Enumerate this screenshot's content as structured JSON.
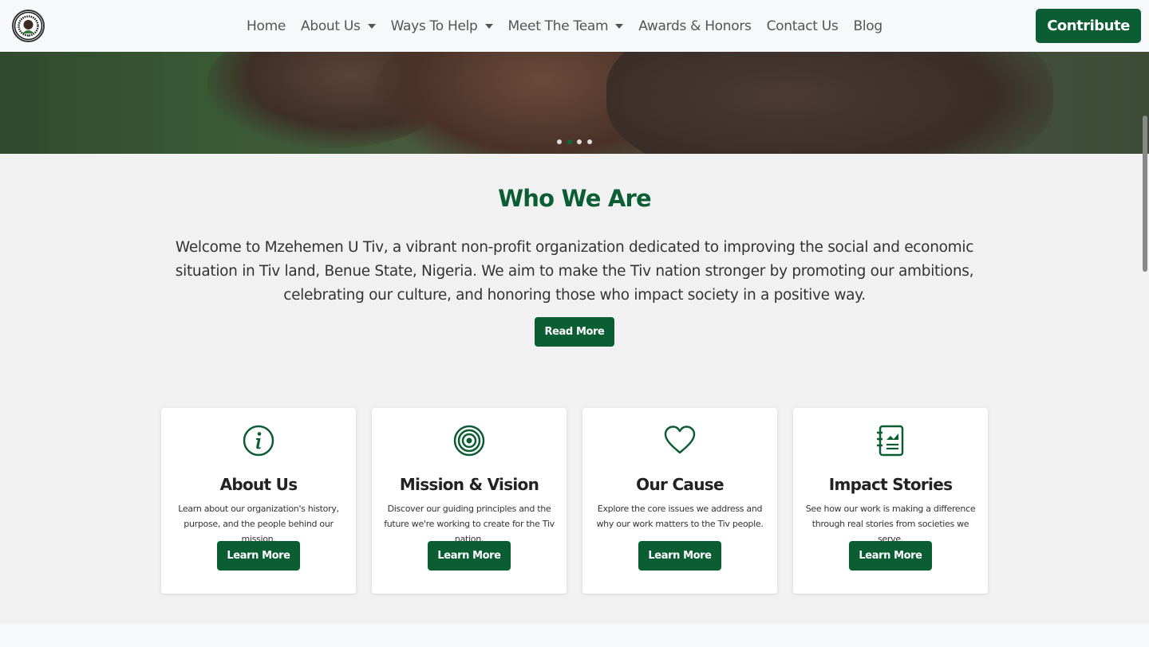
{
  "nav": {
    "links": [
      {
        "label": "Home",
        "active": true,
        "dropdown": false
      },
      {
        "label": "About Us",
        "active": false,
        "dropdown": true
      },
      {
        "label": "Ways To Help",
        "active": false,
        "dropdown": true
      },
      {
        "label": "Meet The Team",
        "active": false,
        "dropdown": true
      },
      {
        "label": "Awards & Honors",
        "active": false,
        "dropdown": false
      },
      {
        "label": "Contact Us",
        "active": false,
        "dropdown": false
      },
      {
        "label": "Blog",
        "active": false,
        "dropdown": false
      }
    ],
    "contribute_label": "Contribute"
  },
  "hero": {
    "slide_count": 4,
    "active_slide": 2
  },
  "who_we_are": {
    "title": "Who We Are",
    "text": "Welcome to Mzehemen U Tiv, a vibrant non-profit organization dedicated to improving the social and economic situation in Tiv land, Benue State, Nigeria. We aim to make the Tiv nation stronger by promoting our ambitions, celebrating our culture, and honoring those who impact society in a positive way.",
    "button_label": "Read More"
  },
  "cards": [
    {
      "icon": "info-icon",
      "title": "About Us",
      "desc": "Learn about our organization's history, purpose, and the people behind our mission.",
      "button": "Learn More"
    },
    {
      "icon": "target-icon",
      "title": "Mission & Vision",
      "desc": "Discover our guiding principles and the future we're working to create for the Tiv nation.",
      "button": "Learn More"
    },
    {
      "icon": "heart-icon",
      "title": "Our Cause",
      "desc": "Explore the core issues we address and why our work matters to the Tiv people.",
      "button": "Learn More"
    },
    {
      "icon": "journal-icon",
      "title": "Impact Stories",
      "desc": "See how our work is making a difference through real stories from societies we serve.",
      "button": "Learn More"
    }
  ],
  "colors": {
    "brand_green": "#0b5e34",
    "active_link": "#0b6b3a"
  }
}
